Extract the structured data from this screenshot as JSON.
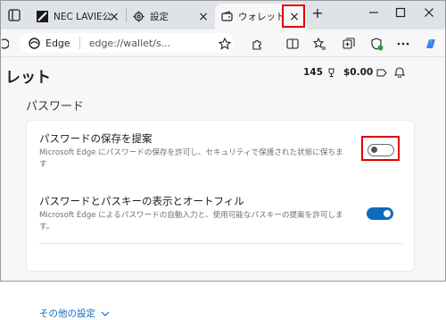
{
  "tabs": [
    {
      "label": "NEC LAVIE公",
      "icon": "nec-favicon-icon"
    },
    {
      "label": "設定",
      "icon": "gear-icon"
    },
    {
      "label": "ウォレット",
      "icon": "wallet-icon",
      "active": true
    }
  ],
  "new_tab_symbol": "+",
  "close_symbol": "×",
  "address": {
    "site": "Edge",
    "url": "edge://wallet/s..."
  },
  "page": {
    "title": "レット",
    "points": "145",
    "cash": "$0.00"
  },
  "section_title": "パスワード",
  "settings": [
    {
      "title": "パスワードの保存を提案",
      "description": "Microsoft Edge にパスワードの保存を許可し、セキュリティで保護された状態に保ちま\nす",
      "enabled": false
    },
    {
      "title": "パスワードとパスキーの表示とオートフィル",
      "description": "Microsoft Edge によるパスワードの自動入力と、使用可能なパスキーの提案を許可しま\nす。",
      "enabled": true
    }
  ],
  "more_settings": "その他の設定",
  "colors": {
    "accent": "#0f6cbd",
    "highlight": "#e00000"
  }
}
